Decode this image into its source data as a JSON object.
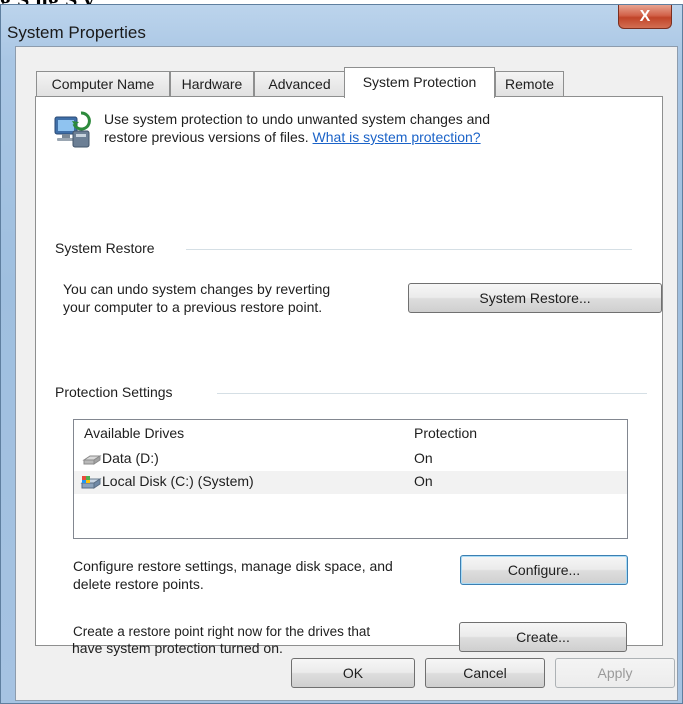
{
  "window": {
    "title": "System Properties",
    "top_cropped_text": "g   S  ng          S     y",
    "close_label": "X"
  },
  "tabs": [
    {
      "label": "Computer Name",
      "active": false
    },
    {
      "label": "Hardware",
      "active": false
    },
    {
      "label": "Advanced",
      "active": false
    },
    {
      "label": "System Protection",
      "active": true
    },
    {
      "label": "Remote",
      "active": false
    }
  ],
  "intro": {
    "line1": "Use system protection to undo unwanted system changes and",
    "line2": "restore previous versions of files.",
    "link": "What is system protection?"
  },
  "system_restore": {
    "group_label": "System Restore",
    "desc_line1": "You can undo system changes by reverting",
    "desc_line2": "your computer to a previous restore point.",
    "button": "System Restore..."
  },
  "protection_settings": {
    "group_label": "Protection Settings",
    "columns": [
      "Available Drives",
      "Protection"
    ],
    "drives": [
      {
        "name": "Data (D:)",
        "protection": "On",
        "icon": "drive-icon"
      },
      {
        "name": "Local Disk (C:) (System)",
        "protection": "On",
        "icon": "system-drive-icon"
      }
    ],
    "configure_line1": "Configure restore settings, manage disk space, and",
    "configure_line2": "delete restore points.",
    "configure_button": "Configure...",
    "create_line1": "Create a restore point right now for the drives that",
    "create_line2": "have system protection turned on.",
    "create_button": "Create..."
  },
  "footer": {
    "ok": "OK",
    "cancel": "Cancel",
    "apply": "Apply"
  }
}
